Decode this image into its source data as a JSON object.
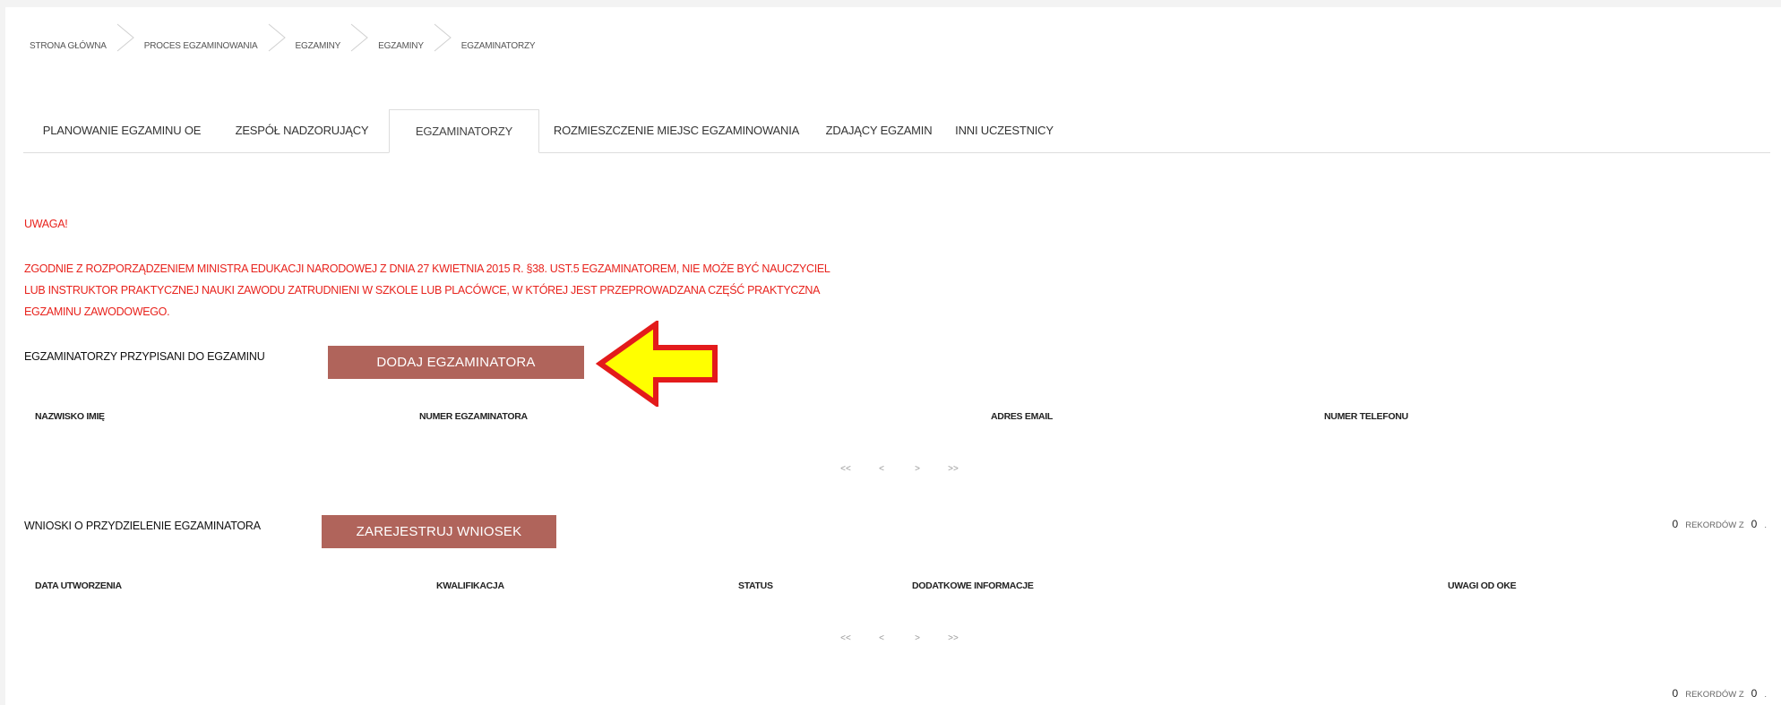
{
  "breadcrumb": [
    "STRONA GŁÓWNA",
    "PROCES EGZAMINOWANIA",
    "EGZAMINY",
    "EGZAMINY",
    "EGZAMINATORZY"
  ],
  "tabs": [
    {
      "label": "PLANOWANIE EGZAMINU OE"
    },
    {
      "label": "ZESPÓŁ NADZORUJĄCY"
    },
    {
      "label": "EGZAMINATORZY"
    },
    {
      "label": "ROZMIESZCZENIE MIEJSC EGZAMINOWANIA"
    },
    {
      "label": "ZDAJĄCY EGZAMIN"
    },
    {
      "label": "INNI UCZESTNICY"
    }
  ],
  "warning": {
    "title": "UWAGA!",
    "lines": [
      "ZGODNIE Z ROZPORZĄDZENIEM MINISTRA EDUKACJI NARODOWEJ Z DNIA 27 KWIETNIA 2015 R. §38. UST.5 EGZAMINATOREM, NIE MOŻE BYĆ NAUCZYCIEL",
      "LUB INSTRUKTOR PRAKTYCZNEJ NAUKI ZAWODU ZATRUDNIENI W SZKOLE LUB PLACÓWCE, W KTÓREJ JEST PRZEPROWADZANA CZĘŚĆ PRAKTYCZNA",
      "EGZAMINU ZAWODOWEGO."
    ]
  },
  "examiners": {
    "title": "EGZAMINATORZY PRZYPISANI DO EGZAMINU",
    "button": "DODAJ EGZAMINATORA",
    "columns": [
      "NAZWISKO IMIĘ",
      "NUMER EGZAMINATORA",
      "ADRES EMAIL",
      "NUMER TELEFONU"
    ],
    "pager": [
      "<<",
      "<",
      ">",
      ">>"
    ],
    "records_count": "0",
    "records_label": "REKORDÓW Z",
    "records_total": "0",
    "records_suffix": "."
  },
  "requests": {
    "title": "WNIOSKI O PRZYDZIELENIE EGZAMINATORA",
    "button": "ZAREJESTRUJ WNIOSEK",
    "columns": [
      "DATA UTWORZENIA",
      "KWALIFIKACJA",
      "STATUS",
      "DODATKOWE INFORMACJE",
      "UWAGI OD OKE"
    ],
    "pager": [
      "<<",
      "<",
      ">",
      ">>"
    ],
    "records_count": "0",
    "records_label": "REKORDÓW Z",
    "records_total": "0",
    "records_suffix": "."
  },
  "colors": {
    "warning": "#e8231d",
    "button": "#b0645b",
    "arrow_fill": "#ffff00",
    "arrow_stroke": "#e31b1b"
  }
}
